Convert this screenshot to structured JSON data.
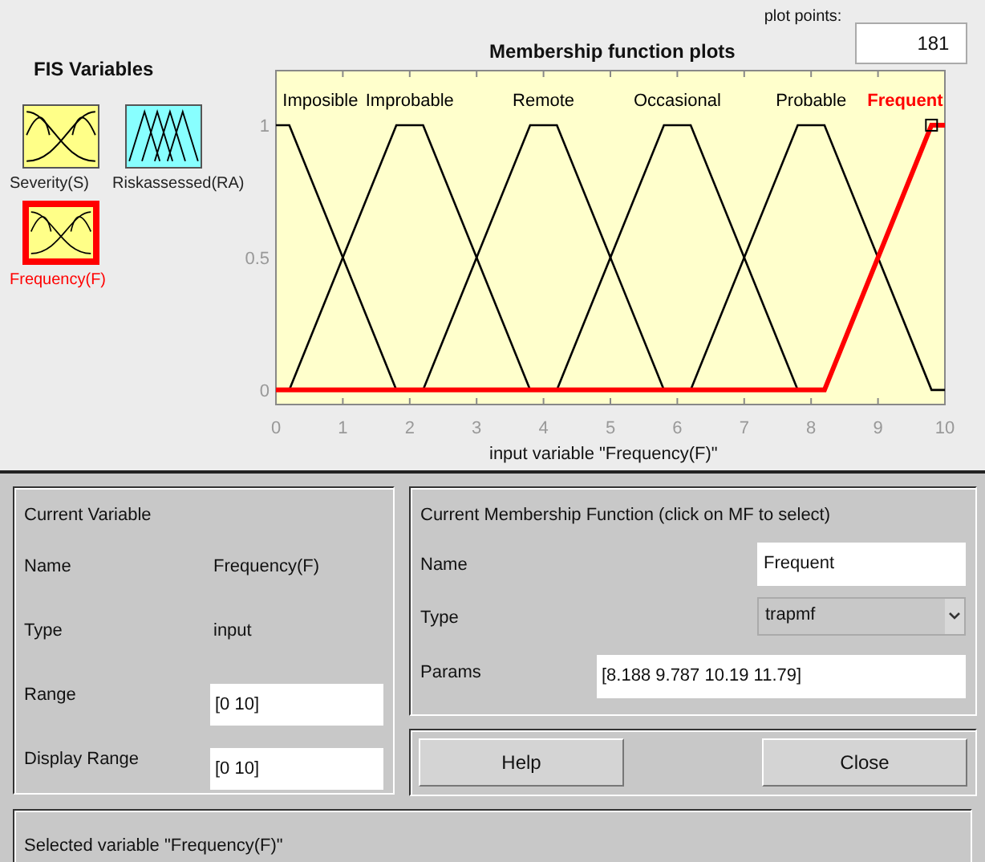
{
  "fis_variables": {
    "title": "FIS Variables",
    "items": [
      {
        "label": "Severity(S)",
        "kind": "input",
        "selected": false
      },
      {
        "label": "Riskassessed(RA)",
        "kind": "output",
        "selected": false
      },
      {
        "label": "Frequency(F)",
        "kind": "input",
        "selected": true
      }
    ]
  },
  "plot": {
    "plot_points_label": "plot points:",
    "plot_points": "181",
    "chart_data": {
      "type": "line",
      "title": "Membership function plots",
      "xlabel": "input variable \"Frequency(F)\"",
      "x": [
        0,
        0.2,
        1.8,
        2.2,
        3.8,
        4.2,
        5.8,
        6.2,
        7.8,
        8.2,
        9.8,
        10
      ],
      "xlim": [
        0,
        10
      ],
      "ylim": [
        -0.055,
        1.206
      ],
      "xticks": [
        0,
        1,
        2,
        3,
        4,
        5,
        6,
        7,
        8,
        9,
        10
      ],
      "yticks": [
        0,
        0.5,
        1
      ],
      "series": [
        {
          "name": "Imposible",
          "color": "#000000",
          "values": [
            1,
            1,
            0,
            null,
            null,
            null,
            null,
            null,
            null,
            null,
            null,
            null
          ]
        },
        {
          "name": "Improbable",
          "color": "#000000",
          "values": [
            null,
            0,
            1,
            1,
            0,
            null,
            null,
            null,
            null,
            null,
            null,
            null
          ]
        },
        {
          "name": "Remote",
          "color": "#000000",
          "values": [
            null,
            null,
            null,
            0,
            1,
            1,
            0,
            null,
            null,
            null,
            null,
            null
          ]
        },
        {
          "name": "Occasional",
          "color": "#000000",
          "values": [
            null,
            null,
            null,
            null,
            null,
            0,
            1,
            1,
            0,
            null,
            null,
            null
          ]
        },
        {
          "name": "Probable",
          "color": "#000000",
          "values": [
            null,
            null,
            null,
            null,
            null,
            null,
            null,
            0,
            1,
            1,
            0,
            0
          ]
        },
        {
          "name": "Frequent",
          "color": "#ff0000",
          "values": [
            0,
            0,
            0,
            0,
            0,
            0,
            0,
            0,
            0,
            0,
            1,
            1
          ]
        }
      ]
    }
  },
  "current_variable": {
    "title": "Current Variable",
    "fields": [
      {
        "label": "Name",
        "kind": "text",
        "value": "Frequency(F)"
      },
      {
        "label": "Type",
        "kind": "text",
        "value": "input"
      },
      {
        "label": "Range",
        "kind": "field",
        "value": "[0 10]"
      },
      {
        "label": "Display Range",
        "kind": "field",
        "value": "[0 10]"
      }
    ]
  },
  "current_mf": {
    "title": "Current Membership Function (click on MF to select)",
    "name_label": "Name",
    "name": "Frequent",
    "type_label": "Type",
    "type": "trapmf",
    "params_label": "Params",
    "params": "[8.188 9.787 10.19 11.79]"
  },
  "buttons": [
    "Help",
    "Close"
  ],
  "status": "Selected variable \"Frequency(F)\""
}
